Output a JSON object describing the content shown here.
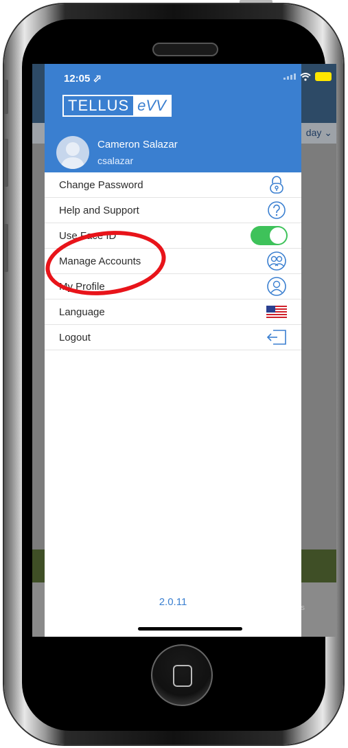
{
  "status_bar": {
    "time": "12:05 ⬀"
  },
  "logo": {
    "part_a": "TELLUS",
    "part_b": "eVV"
  },
  "user": {
    "name": "Cameron Salazar",
    "username": "csalazar"
  },
  "background": {
    "filter_text": "day ⌄",
    "lower_text": "s"
  },
  "menu": {
    "items": [
      {
        "label": "Change Password",
        "icon": "lock-icon"
      },
      {
        "label": "Help and Support",
        "icon": "question-circle-icon"
      },
      {
        "label": "Use Face ID",
        "icon": "toggle-switch",
        "toggle_on": true
      },
      {
        "label": "Manage Accounts",
        "icon": "multi-user-icon"
      },
      {
        "label": "My Profile",
        "icon": "profile-icon"
      },
      {
        "label": "Language",
        "icon": "us-flag-icon"
      },
      {
        "label": "Logout",
        "icon": "logout-icon"
      }
    ]
  },
  "version": "2.0.11",
  "colors": {
    "accent": "#3a7fd0",
    "toggle": "#3ec25a",
    "highlight": "#e8141a"
  }
}
